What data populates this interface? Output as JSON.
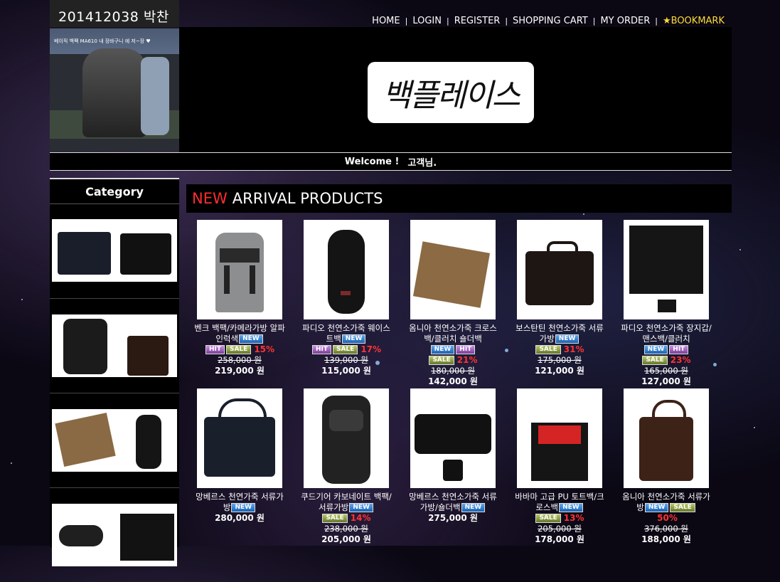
{
  "student_banner": "201412038 박찬형",
  "nav": {
    "home": "HOME",
    "login": "LOGIN",
    "register": "REGISTER",
    "cart": "SHOPPING CART",
    "order": "MY ORDER",
    "bookmark": "★BOOKMARK",
    "separator": "|"
  },
  "logo": "백플레이스",
  "welcome": {
    "greeting": "Welcome !",
    "user": "고객님."
  },
  "sidebar": {
    "title": "Category"
  },
  "arrival": {
    "prefix": "NEW",
    "title": "ARRIVAL PRODUCTS"
  },
  "instagram_caption": "베이직 백팩 MA610 내 장바구니 에 저~장 ♥",
  "products": [
    {
      "name": "벤크 백팩/카메라가방 알파인럭색",
      "badges": [
        "NEW"
      ],
      "badges2": [
        "HIT",
        "SALE"
      ],
      "discount": "15%",
      "old_price": "258,000 원",
      "price": "219,000 원"
    },
    {
      "name": "파디오 천연소가죽 웨이스트백",
      "badges": [
        "NEW"
      ],
      "badges2": [
        "HIT",
        "SALE"
      ],
      "discount": "17%",
      "old_price": "139,000 원",
      "price": "115,000 원"
    },
    {
      "name": "옴니아 천연소가죽 크로스백/클러치 숄더백",
      "badges": [],
      "badges2": [
        "NEW",
        "HIT"
      ],
      "badges3": [
        "SALE"
      ],
      "discount": "21%",
      "old_price": "180,000 원",
      "price": "142,000 원"
    },
    {
      "name": "보스탄틴 천연소가죽 서류가방",
      "badges": [
        "NEW"
      ],
      "badges2": [
        "SALE"
      ],
      "discount": "31%",
      "old_price": "175,000 원",
      "price": "121,000 원"
    },
    {
      "name": "파디오 천연소가죽 장지갑/맨스백/클러치",
      "badges": [],
      "badges2": [
        "NEW",
        "HIT"
      ],
      "badges3": [
        "SALE"
      ],
      "discount": "23%",
      "old_price": "165,000 원",
      "price": "127,000 원"
    },
    {
      "name": "망베르스 천연가죽 서류가방",
      "badges": [
        "NEW"
      ],
      "price": "280,000 원"
    },
    {
      "name": "쿠드기어 카보네이트 백팩/서류가방",
      "badges": [
        "NEW"
      ],
      "badges2": [
        "SALE"
      ],
      "discount": "14%",
      "old_price": "238,000 원",
      "price": "205,000 원"
    },
    {
      "name": "망베르스 천연소가죽 서류가방/숄더백",
      "badges": [
        "NEW"
      ],
      "price": "275,000 원"
    },
    {
      "name": "바바마 고급 PU 토트백/크로스백",
      "badges": [
        "NEW"
      ],
      "badges2": [
        "SALE"
      ],
      "discount": "13%",
      "old_price": "205,000 원",
      "price": "178,000 원"
    },
    {
      "name": "옴니아 천연소가죽 서류가방",
      "badges": [
        "NEW",
        "SALE"
      ],
      "discount": "50%",
      "old_price": "376,000 원",
      "price": "188,000 원"
    }
  ]
}
